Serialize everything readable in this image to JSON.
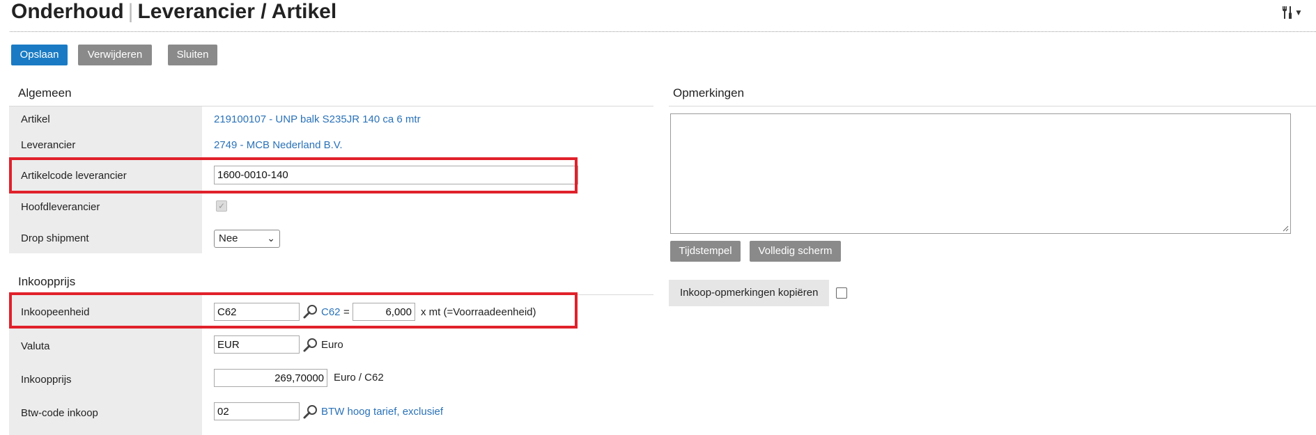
{
  "header": {
    "title_part1": "Onderhoud",
    "title_sep": "|",
    "title_part2": "Leverancier / Artikel",
    "tools_icon": "wrench-screwdriver-icon"
  },
  "toolbar": {
    "save_label": "Opslaan",
    "delete_label": "Verwijderen",
    "close_label": "Sluiten"
  },
  "algemeen": {
    "section_title": "Algemeen",
    "artikel_label": "Artikel",
    "artikel_value": "219100107 - UNP balk S235JR 140 ca 6 mtr",
    "leverancier_label": "Leverancier",
    "leverancier_value": "2749 - MCB Nederland B.V.",
    "artikelcode_label": "Artikelcode leverancier",
    "artikelcode_value": "1600-0010-140",
    "hoofdleverancier_label": "Hoofdleverancier",
    "hoofdleverancier_checked": true,
    "drop_shipment_label": "Drop shipment",
    "drop_shipment_value": "Nee"
  },
  "inkoopprijs": {
    "section_title": "Inkoopprijs",
    "inkoopeenheid_label": "Inkoopeenheid",
    "inkoopeenheid_value": "C62",
    "inkoopeenheid_link": "C62",
    "equals": "=",
    "factor_value": "6,000",
    "factor_suffix": "x mt (=Voorraadeenheid)",
    "valuta_label": "Valuta",
    "valuta_value": "EUR",
    "valuta_desc": "Euro",
    "prijs_label": "Inkoopprijs",
    "prijs_value": "269,70000",
    "prijs_suffix": "Euro / C62",
    "btw_label": "Btw-code inkoop",
    "btw_value": "02",
    "btw_desc": "BTW hoog tarief, exclusief"
  },
  "opmerkingen": {
    "section_title": "Opmerkingen",
    "value": "",
    "timestamp_label": "Tijdstempel",
    "fullscreen_label": "Volledig scherm",
    "copy_label": "Inkoop-opmerkingen kopiëren",
    "copy_checked": false
  },
  "colors": {
    "primary": "#1a7bc4",
    "grey_button": "#8a8a8a",
    "link": "#2a72b8",
    "highlight": "#e0212b"
  }
}
